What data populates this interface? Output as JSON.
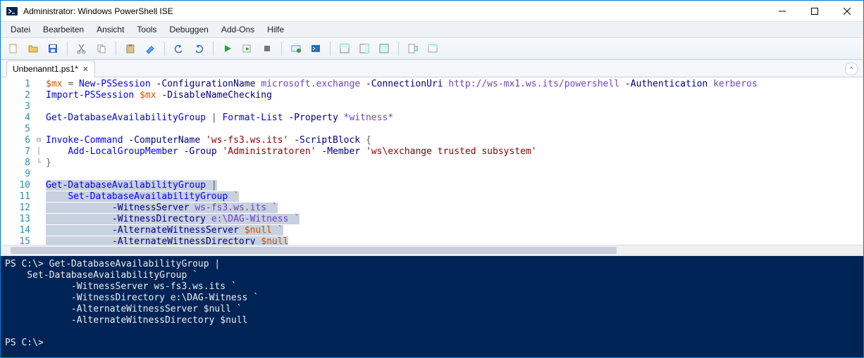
{
  "window": {
    "title": "Administrator: Windows PowerShell ISE"
  },
  "menu": {
    "items": [
      "Datei",
      "Bearbeiten",
      "Ansicht",
      "Tools",
      "Debuggen",
      "Add-Ons",
      "Hilfe"
    ]
  },
  "tab": {
    "label": "Unbenannt1.ps1*"
  },
  "code": {
    "lines": [
      [
        {
          "t": "$mx",
          "c": "tok-var"
        },
        {
          "t": " "
        },
        {
          "t": "=",
          "c": "tok-op"
        },
        {
          "t": " "
        },
        {
          "t": "New-PSSession",
          "c": "tok-cmd"
        },
        {
          "t": " "
        },
        {
          "t": "-ConfigurationName",
          "c": "tok-param"
        },
        {
          "t": " "
        },
        {
          "t": "microsoft.exchange",
          "c": "tok-ident"
        },
        {
          "t": " "
        },
        {
          "t": "-ConnectionUri",
          "c": "tok-param"
        },
        {
          "t": " "
        },
        {
          "t": "http://ws-mx1.ws.its/powershell",
          "c": "tok-ident"
        },
        {
          "t": " "
        },
        {
          "t": "-Authentication",
          "c": "tok-param"
        },
        {
          "t": " "
        },
        {
          "t": "kerberos",
          "c": "tok-ident"
        }
      ],
      [
        {
          "t": "Import-PSSession",
          "c": "tok-cmd"
        },
        {
          "t": " "
        },
        {
          "t": "$mx",
          "c": "tok-var"
        },
        {
          "t": " "
        },
        {
          "t": "-DisableNameChecking",
          "c": "tok-param"
        }
      ],
      [
        {
          "t": ""
        }
      ],
      [
        {
          "t": "Get-DatabaseAvailabilityGroup",
          "c": "tok-cmd"
        },
        {
          "t": " "
        },
        {
          "t": "|",
          "c": "tok-op"
        },
        {
          "t": " "
        },
        {
          "t": "Format-List",
          "c": "tok-cmd"
        },
        {
          "t": " "
        },
        {
          "t": "-Property",
          "c": "tok-param"
        },
        {
          "t": " "
        },
        {
          "t": "*witness*",
          "c": "tok-ident"
        }
      ],
      [
        {
          "t": ""
        }
      ],
      [
        {
          "t": "Invoke-Command",
          "c": "tok-cmd"
        },
        {
          "t": " "
        },
        {
          "t": "-ComputerName",
          "c": "tok-param"
        },
        {
          "t": " "
        },
        {
          "t": "'ws-fs3.ws.its'",
          "c": "tok-string"
        },
        {
          "t": " "
        },
        {
          "t": "-ScriptBlock",
          "c": "tok-param"
        },
        {
          "t": " "
        },
        {
          "t": "{",
          "c": "tok-punct"
        }
      ],
      [
        {
          "t": "    "
        },
        {
          "t": "Add-LocalGroupMember",
          "c": "tok-cmd"
        },
        {
          "t": " "
        },
        {
          "t": "-Group",
          "c": "tok-param"
        },
        {
          "t": " "
        },
        {
          "t": "'Administratoren'",
          "c": "tok-string"
        },
        {
          "t": " "
        },
        {
          "t": "-Member",
          "c": "tok-param"
        },
        {
          "t": " "
        },
        {
          "t": "'ws\\exchange trusted subsystem'",
          "c": "tok-string"
        }
      ],
      [
        {
          "t": "}",
          "c": "tok-punct"
        }
      ],
      [
        {
          "t": ""
        }
      ],
      [
        {
          "t": "Get-DatabaseAvailabilityGroup",
          "c": "tok-cmd",
          "sel": true
        },
        {
          "t": " ",
          "sel": true
        },
        {
          "t": "|",
          "c": "tok-op",
          "sel": true
        }
      ],
      [
        {
          "t": "    ",
          "sel": true
        },
        {
          "t": "Set-DatabaseAvailabilityGroup",
          "c": "tok-cmd",
          "sel": true
        },
        {
          "t": " `",
          "c": "tok-punct",
          "sel": true
        }
      ],
      [
        {
          "t": "            ",
          "sel": true
        },
        {
          "t": "-WitnessServer",
          "c": "tok-param",
          "sel": true
        },
        {
          "t": " ",
          "sel": true
        },
        {
          "t": "ws-fs3.ws.its",
          "c": "tok-ident",
          "sel": true
        },
        {
          "t": " `",
          "c": "tok-punct",
          "sel": true
        }
      ],
      [
        {
          "t": "            ",
          "sel": true
        },
        {
          "t": "-WitnessDirectory",
          "c": "tok-param",
          "sel": true
        },
        {
          "t": " ",
          "sel": true
        },
        {
          "t": "e:\\DAG-Witness",
          "c": "tok-ident",
          "sel": true
        },
        {
          "t": " `",
          "c": "tok-punct",
          "sel": true
        }
      ],
      [
        {
          "t": "            ",
          "sel": true
        },
        {
          "t": "-AlternateWitnessServer",
          "c": "tok-param",
          "sel": true
        },
        {
          "t": " ",
          "sel": true
        },
        {
          "t": "$null",
          "c": "tok-var",
          "sel": true
        },
        {
          "t": " `",
          "c": "tok-punct",
          "sel": true
        }
      ],
      [
        {
          "t": "            ",
          "sel": true
        },
        {
          "t": "-AlternateWitnessDirectory",
          "c": "tok-param",
          "sel": true
        },
        {
          "t": " ",
          "sel": true
        },
        {
          "t": "$null",
          "c": "tok-var",
          "sel": true
        }
      ]
    ],
    "fold_markers": {
      "6": "⊟",
      "7": "│",
      "8": "└"
    }
  },
  "console": {
    "lines": [
      "PS C:\\> Get-DatabaseAvailabilityGroup |",
      "    Set-DatabaseAvailabilityGroup `",
      "            -WitnessServer ws-fs3.ws.its `",
      "            -WitnessDirectory e:\\DAG-Witness `",
      "            -AlternateWitnessServer $null `",
      "            -AlternateWitnessDirectory $null",
      "",
      "PS C:\\> "
    ]
  }
}
